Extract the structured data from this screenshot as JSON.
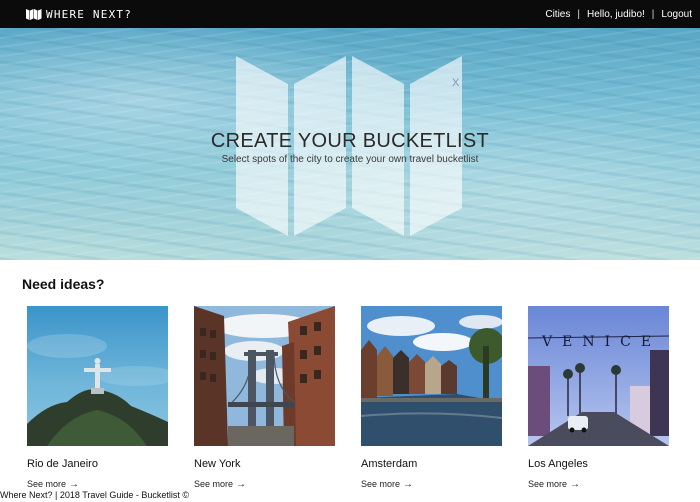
{
  "navbar": {
    "brand": "WHERE NEXT?",
    "links": [
      "Cities",
      "Hello, judibo!",
      "Logout"
    ],
    "separator": "|"
  },
  "hero": {
    "title": "CREATE YOUR BUCKETLIST",
    "subtitle": "Select spots of the city to create your own travel bucketlist",
    "map_mark": "X"
  },
  "ideas": {
    "title": "Need ideas?",
    "see_more": "See more",
    "arrow": "→",
    "cities": [
      {
        "name": "Rio de Janeiro"
      },
      {
        "name": "New York"
      },
      {
        "name": "Amsterdam"
      },
      {
        "name": "Los Angeles"
      }
    ]
  },
  "venice_sign": "VENICE",
  "footer": {
    "text": "Where Next? | 2018 Travel Guide - Bucketlist ©"
  }
}
